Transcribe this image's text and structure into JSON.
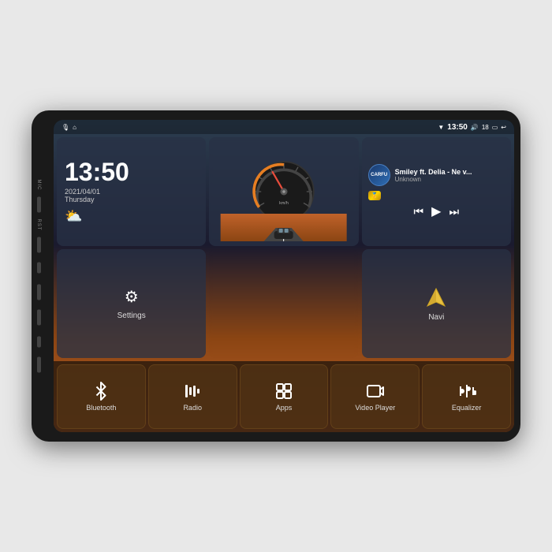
{
  "device": {
    "side_labels": [
      "MIC",
      "RST"
    ]
  },
  "status_bar": {
    "left_icon": "mic",
    "home_icon": "🏠",
    "time": "13:50",
    "wifi_icon": "wifi",
    "volume": "18",
    "screen_icon": "▭",
    "back_icon": "↩"
  },
  "clock_widget": {
    "time": "13:50",
    "date": "2021/04/01",
    "day": "Thursday",
    "weather": "⛅"
  },
  "music_widget": {
    "logo_text": "CARFU",
    "title": "Smiley ft. Delia - Ne v...",
    "artist": "Unknown"
  },
  "settings_widget": {
    "icon": "⚙",
    "label": "Settings"
  },
  "navi_widget": {
    "icon": "▲",
    "label": "Navi"
  },
  "bottom_items": [
    {
      "id": "bluetooth",
      "icon": "bluetooth",
      "label": "Bluetooth"
    },
    {
      "id": "radio",
      "icon": "radio",
      "label": "Radio"
    },
    {
      "id": "apps",
      "icon": "apps",
      "label": "Apps"
    },
    {
      "id": "video_player",
      "icon": "video",
      "label": "Video Player"
    },
    {
      "id": "equalizer",
      "icon": "equalizer",
      "label": "Equalizer"
    }
  ],
  "speedometer": {
    "unit": "km/h"
  }
}
